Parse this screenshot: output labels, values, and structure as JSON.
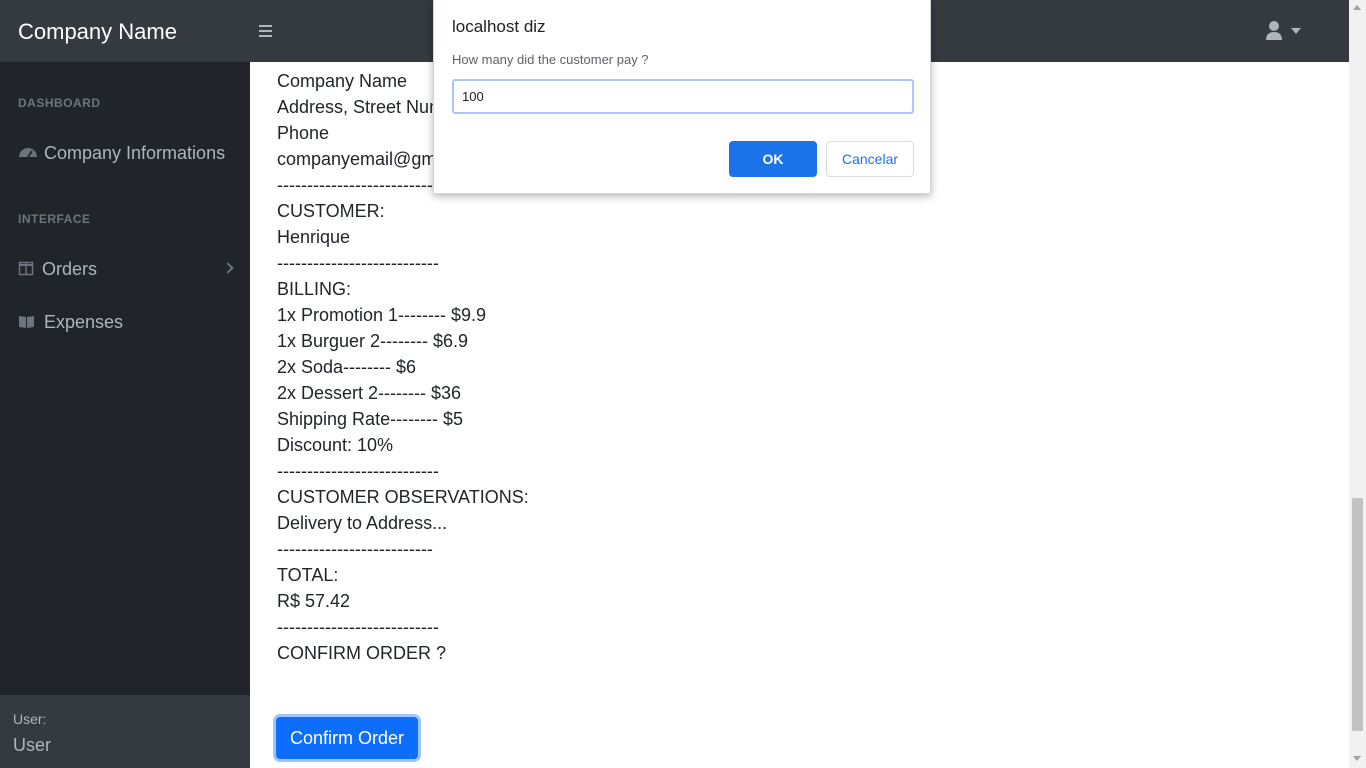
{
  "header": {
    "brand": "Company Name",
    "menu_icon": "hamburger-icon",
    "user_icon": "user-icon"
  },
  "sidebar": {
    "section_dashboard": "DASHBOARD",
    "section_interface": "INTERFACE",
    "items": [
      {
        "label": "Company Informations",
        "icon": "tachometer-icon"
      },
      {
        "label": "Orders",
        "icon": "columns-icon"
      },
      {
        "label": "Expenses",
        "icon": "book-icon"
      }
    ],
    "footer_label": "User:",
    "footer_user": "User"
  },
  "receipt": {
    "lines": [
      "Company Name",
      "Address, Street Number",
      "Phone",
      "companyemail@gmail.com",
      "---------------------------",
      "CUSTOMER:",
      "Henrique",
      "---------------------------",
      "BILLING:",
      "1x Promotion 1-------- $9.9",
      "1x Burguer 2-------- $6.9",
      "2x Soda-------- $6",
      "2x Dessert 2-------- $36",
      "Shipping Rate-------- $5",
      "Discount: 10%",
      "---------------------------",
      "CUSTOMER OBSERVATIONS:",
      "Delivery to Address...",
      "--------------------------",
      "TOTAL:",
      "R$ 57.42",
      "---------------------------",
      "CONFIRM ORDER ?"
    ]
  },
  "confirm_button": "Confirm Order",
  "dialog": {
    "title": "localhost diz",
    "message": "How many did the customer pay ?",
    "input_value": "100",
    "ok_label": "OK",
    "cancel_label": "Cancelar"
  },
  "colors": {
    "navbar": "#343a40",
    "sidebar": "#212529",
    "primary": "#0d6efd",
    "dialog_primary": "#1a73e8"
  }
}
